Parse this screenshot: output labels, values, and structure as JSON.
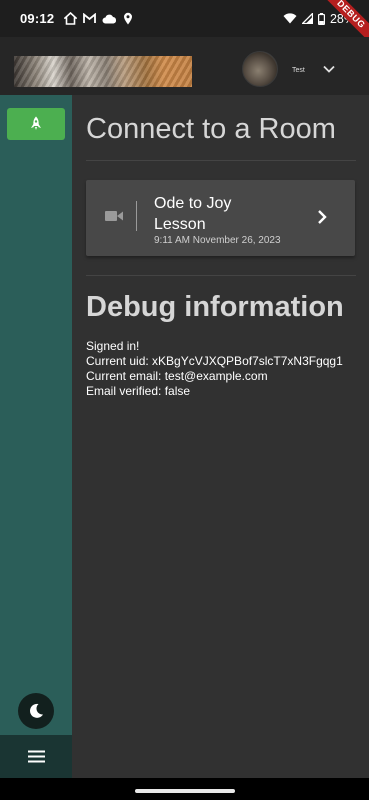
{
  "status_bar": {
    "time": "09:12",
    "left_icons": [
      "home-icon",
      "gmail-icon",
      "cloud-icon",
      "location-icon"
    ],
    "right_icons": [
      "wifi-icon",
      "cellular-signal-icon",
      "battery-icon"
    ],
    "battery": "28%",
    "debug_banner": "DEBUG",
    "colors": {
      "background": "#1e1e1e",
      "debug_ribbon": "#b51f1f"
    }
  },
  "app_bar": {
    "user_name": "Test",
    "menu_icon": "chevron-down-icon",
    "colors": {
      "background": "#262626"
    }
  },
  "sidebar": {
    "items": [
      {
        "icon": "rocket-icon",
        "active": true
      }
    ],
    "theme_toggle_icon": "moon-icon",
    "menu_icon": "hamburger-menu-icon",
    "colors": {
      "background": "#2b5e59",
      "active_item": "#4caf50",
      "footer": "#1a3533"
    }
  },
  "main": {
    "title": "Connect to a Room",
    "rooms": [
      {
        "icon": "video-camera-icon",
        "name": "Ode to Joy Lesson",
        "time": "9:11 AM November 26, 2023",
        "action_icon": "chevron-right-icon"
      }
    ],
    "debug": {
      "title": "Debug information",
      "lines": [
        "Signed in!",
        "Current uid: xKBgYcVJXQPBof7slcT7xN3Fgqg1",
        "Current email: test@example.com",
        "Email verified: false"
      ]
    },
    "colors": {
      "background": "#313131",
      "card": "#484848",
      "title": "#d6d6d6"
    }
  }
}
